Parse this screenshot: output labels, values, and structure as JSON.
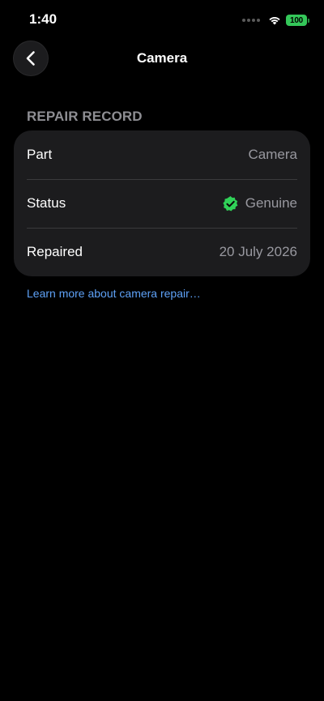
{
  "status_bar": {
    "time": "1:40",
    "battery_level": "100",
    "battery_color": "#34c759",
    "icons": [
      "signal-dots-icon",
      "wifi-icon",
      "battery-icon"
    ]
  },
  "nav": {
    "back_icon": "chevron-left-icon",
    "title": "Camera"
  },
  "section": {
    "header": "REPAIR RECORD"
  },
  "repair_record": {
    "rows": [
      {
        "label": "Part",
        "value": "Camera"
      },
      {
        "label": "Status",
        "value": "Genuine",
        "icon": "verified-check-icon",
        "icon_color": "#30d158"
      },
      {
        "label": "Repaired",
        "value": "20 July 2026"
      }
    ]
  },
  "link": {
    "text": "Learn more about camera repair…",
    "color": "#5ea1f6"
  }
}
